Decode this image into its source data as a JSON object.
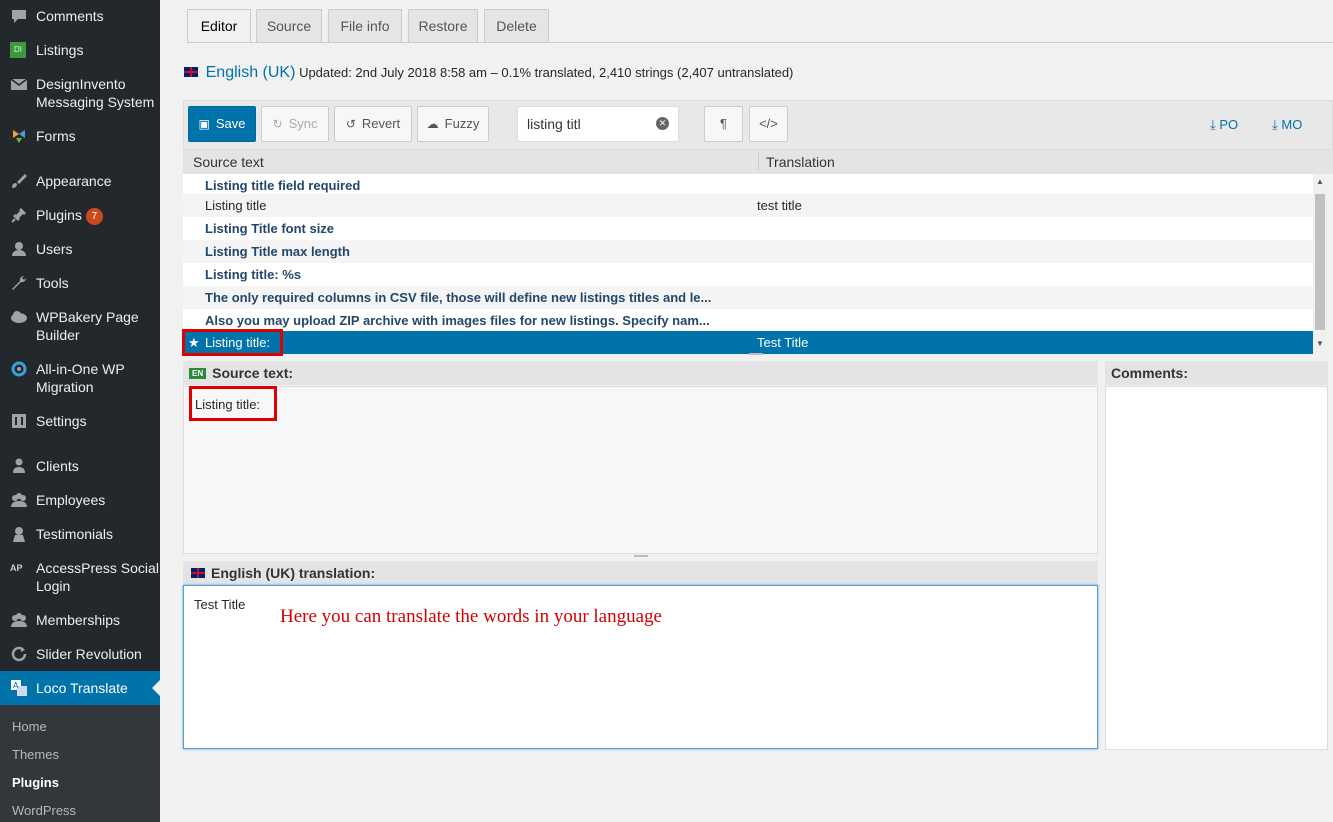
{
  "sidebar": {
    "items": [
      {
        "label": "Comments",
        "icon": "comment-icon"
      },
      {
        "label": "Listings",
        "icon": "listings-di-icon",
        "icon_text": "DI"
      },
      {
        "label": "DesignInvento Messaging System",
        "icon": "envelope-icon"
      },
      {
        "label": "Forms",
        "icon": "forms-icon"
      },
      {
        "label": "Appearance",
        "icon": "paintbrush-icon"
      },
      {
        "label": "Plugins",
        "icon": "plugin-icon",
        "badge": "7"
      },
      {
        "label": "Users",
        "icon": "user-icon"
      },
      {
        "label": "Tools",
        "icon": "wrench-icon"
      },
      {
        "label": "WPBakery Page Builder",
        "icon": "cloud-icon"
      },
      {
        "label": "All-in-One WP Migration",
        "icon": "migration-icon"
      },
      {
        "label": "Settings",
        "icon": "settings-icon"
      },
      {
        "label": "Clients",
        "icon": "client-icon"
      },
      {
        "label": "Employees",
        "icon": "group-icon"
      },
      {
        "label": "Testimonials",
        "icon": "testimonial-icon"
      },
      {
        "label": "AccessPress Social Login",
        "icon": "ap-icon",
        "icon_text": "AP"
      },
      {
        "label": "Memberships",
        "icon": "group-icon"
      },
      {
        "label": "Slider Revolution",
        "icon": "refresh-icon"
      },
      {
        "label": "Loco Translate",
        "icon": "translate-icon",
        "active": true
      }
    ],
    "submenu": [
      "Home",
      "Themes",
      "Plugins",
      "WordPress"
    ],
    "submenu_current": "Plugins"
  },
  "tabs": [
    "Editor",
    "Source",
    "File info",
    "Restore",
    "Delete"
  ],
  "active_tab": "Editor",
  "header": {
    "language": "English (UK)",
    "status": "Updated: 2nd July 2018 8:58 am – 0.1% translated, 2,410 strings (2,407 untranslated)"
  },
  "toolbar": {
    "save": "Save",
    "sync": "Sync",
    "revert": "Revert",
    "fuzzy": "Fuzzy",
    "search_value": "listing titl",
    "pilcrow": "¶",
    "code": "</>",
    "po": "PO",
    "mo": "MO"
  },
  "table": {
    "columns": [
      "Source text",
      "Translation"
    ],
    "rows": [
      {
        "source": "Listing title field required",
        "translation": "",
        "untranslated": true
      },
      {
        "source": "Listing title",
        "translation": "test title",
        "untranslated": false
      },
      {
        "source": "Listing Title font size",
        "translation": "",
        "untranslated": true
      },
      {
        "source": "Listing Title max length",
        "translation": "",
        "untranslated": true
      },
      {
        "source": "Listing title: %s",
        "translation": "",
        "untranslated": true
      },
      {
        "source": "The only required columns in CSV file, those will define new listings titles and le...",
        "translation": "",
        "untranslated": true
      },
      {
        "source": "Also you may upload ZIP archive with images files for new listings. Specify nam...",
        "translation": "",
        "untranslated": true
      },
      {
        "source": "Listing title:",
        "translation": "Test Title",
        "untranslated": false,
        "selected": true
      }
    ]
  },
  "source_panel": {
    "title": "Source text:",
    "lang_badge": "EN",
    "text": "Listing title:"
  },
  "translation_panel": {
    "title": "English (UK) translation:",
    "value": "Test Title",
    "annotation": "Here you can translate the words in your language"
  },
  "comments_panel": {
    "title": "Comments:"
  },
  "colors": {
    "sidebar_bg": "#23282d",
    "accent": "#0073aa",
    "highlight_box": "#e00000",
    "annotation": "#d40000"
  }
}
